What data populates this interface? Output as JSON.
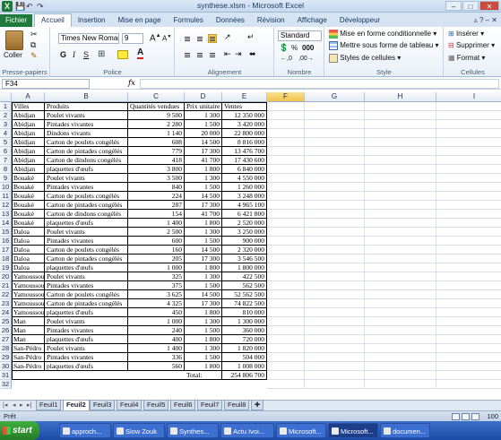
{
  "window": {
    "title": "synthese.xlsm  -  Microsoft Excel",
    "app_letter": "X"
  },
  "quick_access": {
    "save": "💾",
    "undo": "↶",
    "redo": "↷"
  },
  "window_buttons": {
    "minimize": "–",
    "maximize": "□",
    "close": "✕"
  },
  "tabs": [
    "Fichier",
    "Accueil",
    "Insertion",
    "Mise en page",
    "Formules",
    "Données",
    "Révision",
    "Affichage",
    "Développeur"
  ],
  "help_icons": "▵ ? – ✕",
  "ribbon": {
    "clipboard": {
      "paste": "Coller",
      "label": "Presse-papiers"
    },
    "font": {
      "name": "Times New Roman",
      "size": "9",
      "label": "Police"
    },
    "alignment": {
      "label": "Alignement"
    },
    "number": {
      "format": "Standard",
      "label": "Nombre"
    },
    "style": {
      "conditional": "Mise en forme conditionnelle",
      "table": "Mettre sous forme de tableau",
      "cell_styles": "Styles de cellules",
      "label": "Style"
    },
    "cells": {
      "insert": "Insérer",
      "delete": "Supprimer",
      "format": "Format",
      "label": "Cellules"
    }
  },
  "formula_bar": {
    "name_box": "F34",
    "fx": "fx",
    "value": ""
  },
  "columns": [
    "A",
    "B",
    "C",
    "D",
    "E",
    "F",
    "G",
    "H",
    "I"
  ],
  "header_row": [
    "Villes",
    "Produits",
    "Quantités vendues",
    "Prix unitaire",
    "Ventes"
  ],
  "rows": [
    [
      "Abidjan",
      "Poulet vivants",
      "9 500",
      "1 300",
      "12 350 000"
    ],
    [
      "Abidjan",
      "Pintades vivantes",
      "2 280",
      "1 500",
      "3 420 000"
    ],
    [
      "Abidjan",
      "Dindons vivants",
      "1 140",
      "20 000",
      "22 800 000"
    ],
    [
      "Abidjan",
      "Carton de poulets congélés",
      "608",
      "14 500",
      "8 816 000"
    ],
    [
      "Abidjan",
      "Carton de pintades congélés",
      "779",
      "17 300",
      "13 476 700"
    ],
    [
      "Abidjan",
      "Carton de dindons congélés",
      "418",
      "41 700",
      "17 430 600"
    ],
    [
      "Abidjan",
      "plaquettes d'œufs",
      "3 800",
      "1 800",
      "6 840 000"
    ],
    [
      "Bouaké",
      "Poulet vivants",
      "3 500",
      "1 300",
      "4 550 000"
    ],
    [
      "Bouaké",
      "Pintades vivantes",
      "840",
      "1 500",
      "1 260 000"
    ],
    [
      "Bouaké",
      "Carton de poulets congélés",
      "224",
      "14 500",
      "3 248 000"
    ],
    [
      "Bouaké",
      "Carton de pintades congélés",
      "287",
      "17 300",
      "4 965 100"
    ],
    [
      "Bouaké",
      "Carton de dindons congélés",
      "154",
      "41 700",
      "6 421 800"
    ],
    [
      "Bouaké",
      "plaquettes d'œufs",
      "1 400",
      "1 800",
      "2 520 000"
    ],
    [
      "Daloa",
      "Poulet vivants",
      "2 500",
      "1 300",
      "3 250 000"
    ],
    [
      "Daloa",
      "Pintades vivantes",
      "600",
      "1 500",
      "900 000"
    ],
    [
      "Daloa",
      "Carton de poulets congélés",
      "160",
      "14 500",
      "2 320 000"
    ],
    [
      "Daloa",
      "Carton de pintades congélés",
      "205",
      "17 300",
      "3 546 500"
    ],
    [
      "Daloa",
      "plaquettes d'œufs",
      "1 000",
      "1 800",
      "1 800 000"
    ],
    [
      "Yamoussoukro",
      "Poulet vivants",
      "325",
      "1 300",
      "422 500"
    ],
    [
      "Yamoussoukro",
      "Pintades vivantes",
      "375",
      "1 500",
      "562 500"
    ],
    [
      "Yamoussoukro",
      "Carton de poulets congélés",
      "3 625",
      "14 500",
      "52 562 500"
    ],
    [
      "Yamoussoukro",
      "Carton de pintades congélés",
      "4 325",
      "17 300",
      "74 822 500"
    ],
    [
      "Yamoussoukro",
      "plaquettes d'œufs",
      "450",
      "1 800",
      "810 000"
    ],
    [
      "Man",
      "Poulet vivants",
      "1 000",
      "1 300",
      "1 300 000"
    ],
    [
      "Man",
      "Pintades vivantes",
      "240",
      "1 500",
      "360 000"
    ],
    [
      "Man",
      "plaquettes d'œufs",
      "400",
      "1 800",
      "720 000"
    ],
    [
      "San-Pédro",
      "Poulet vivants",
      "1 400",
      "1 300",
      "1 820 000"
    ],
    [
      "San-Pédro",
      "Pintades vivantes",
      "336",
      "1 500",
      "504 000"
    ],
    [
      "San-Pédro",
      "plaquettes d'œufs",
      "560",
      "1 800",
      "1 008 000"
    ]
  ],
  "total": {
    "label": "Total:",
    "value": "254 806 700"
  },
  "row_numbers": [
    "1",
    "2",
    "3",
    "4",
    "5",
    "6",
    "7",
    "8",
    "9",
    "10",
    "11",
    "12",
    "13",
    "14",
    "15",
    "16",
    "17",
    "18",
    "19",
    "20",
    "21",
    "22",
    "23",
    "24",
    "25",
    "26",
    "27",
    "28",
    "29",
    "30",
    "31",
    "32"
  ],
  "sheets": [
    "Feuil1",
    "Feuil2",
    "Feuil3",
    "Feuil4",
    "Feuil5",
    "Feuil6",
    "Feuil7",
    "Feuil8"
  ],
  "active_sheet": "Feuil2",
  "status": {
    "ready": "Prêt",
    "zoom": "100"
  },
  "taskbar": {
    "start": "start",
    "items": [
      "approch...",
      "Slow Zouk",
      "Synthes...",
      "Actu Ivoi...",
      "Microsoft...",
      "Microsoft...",
      "documen..."
    ]
  }
}
